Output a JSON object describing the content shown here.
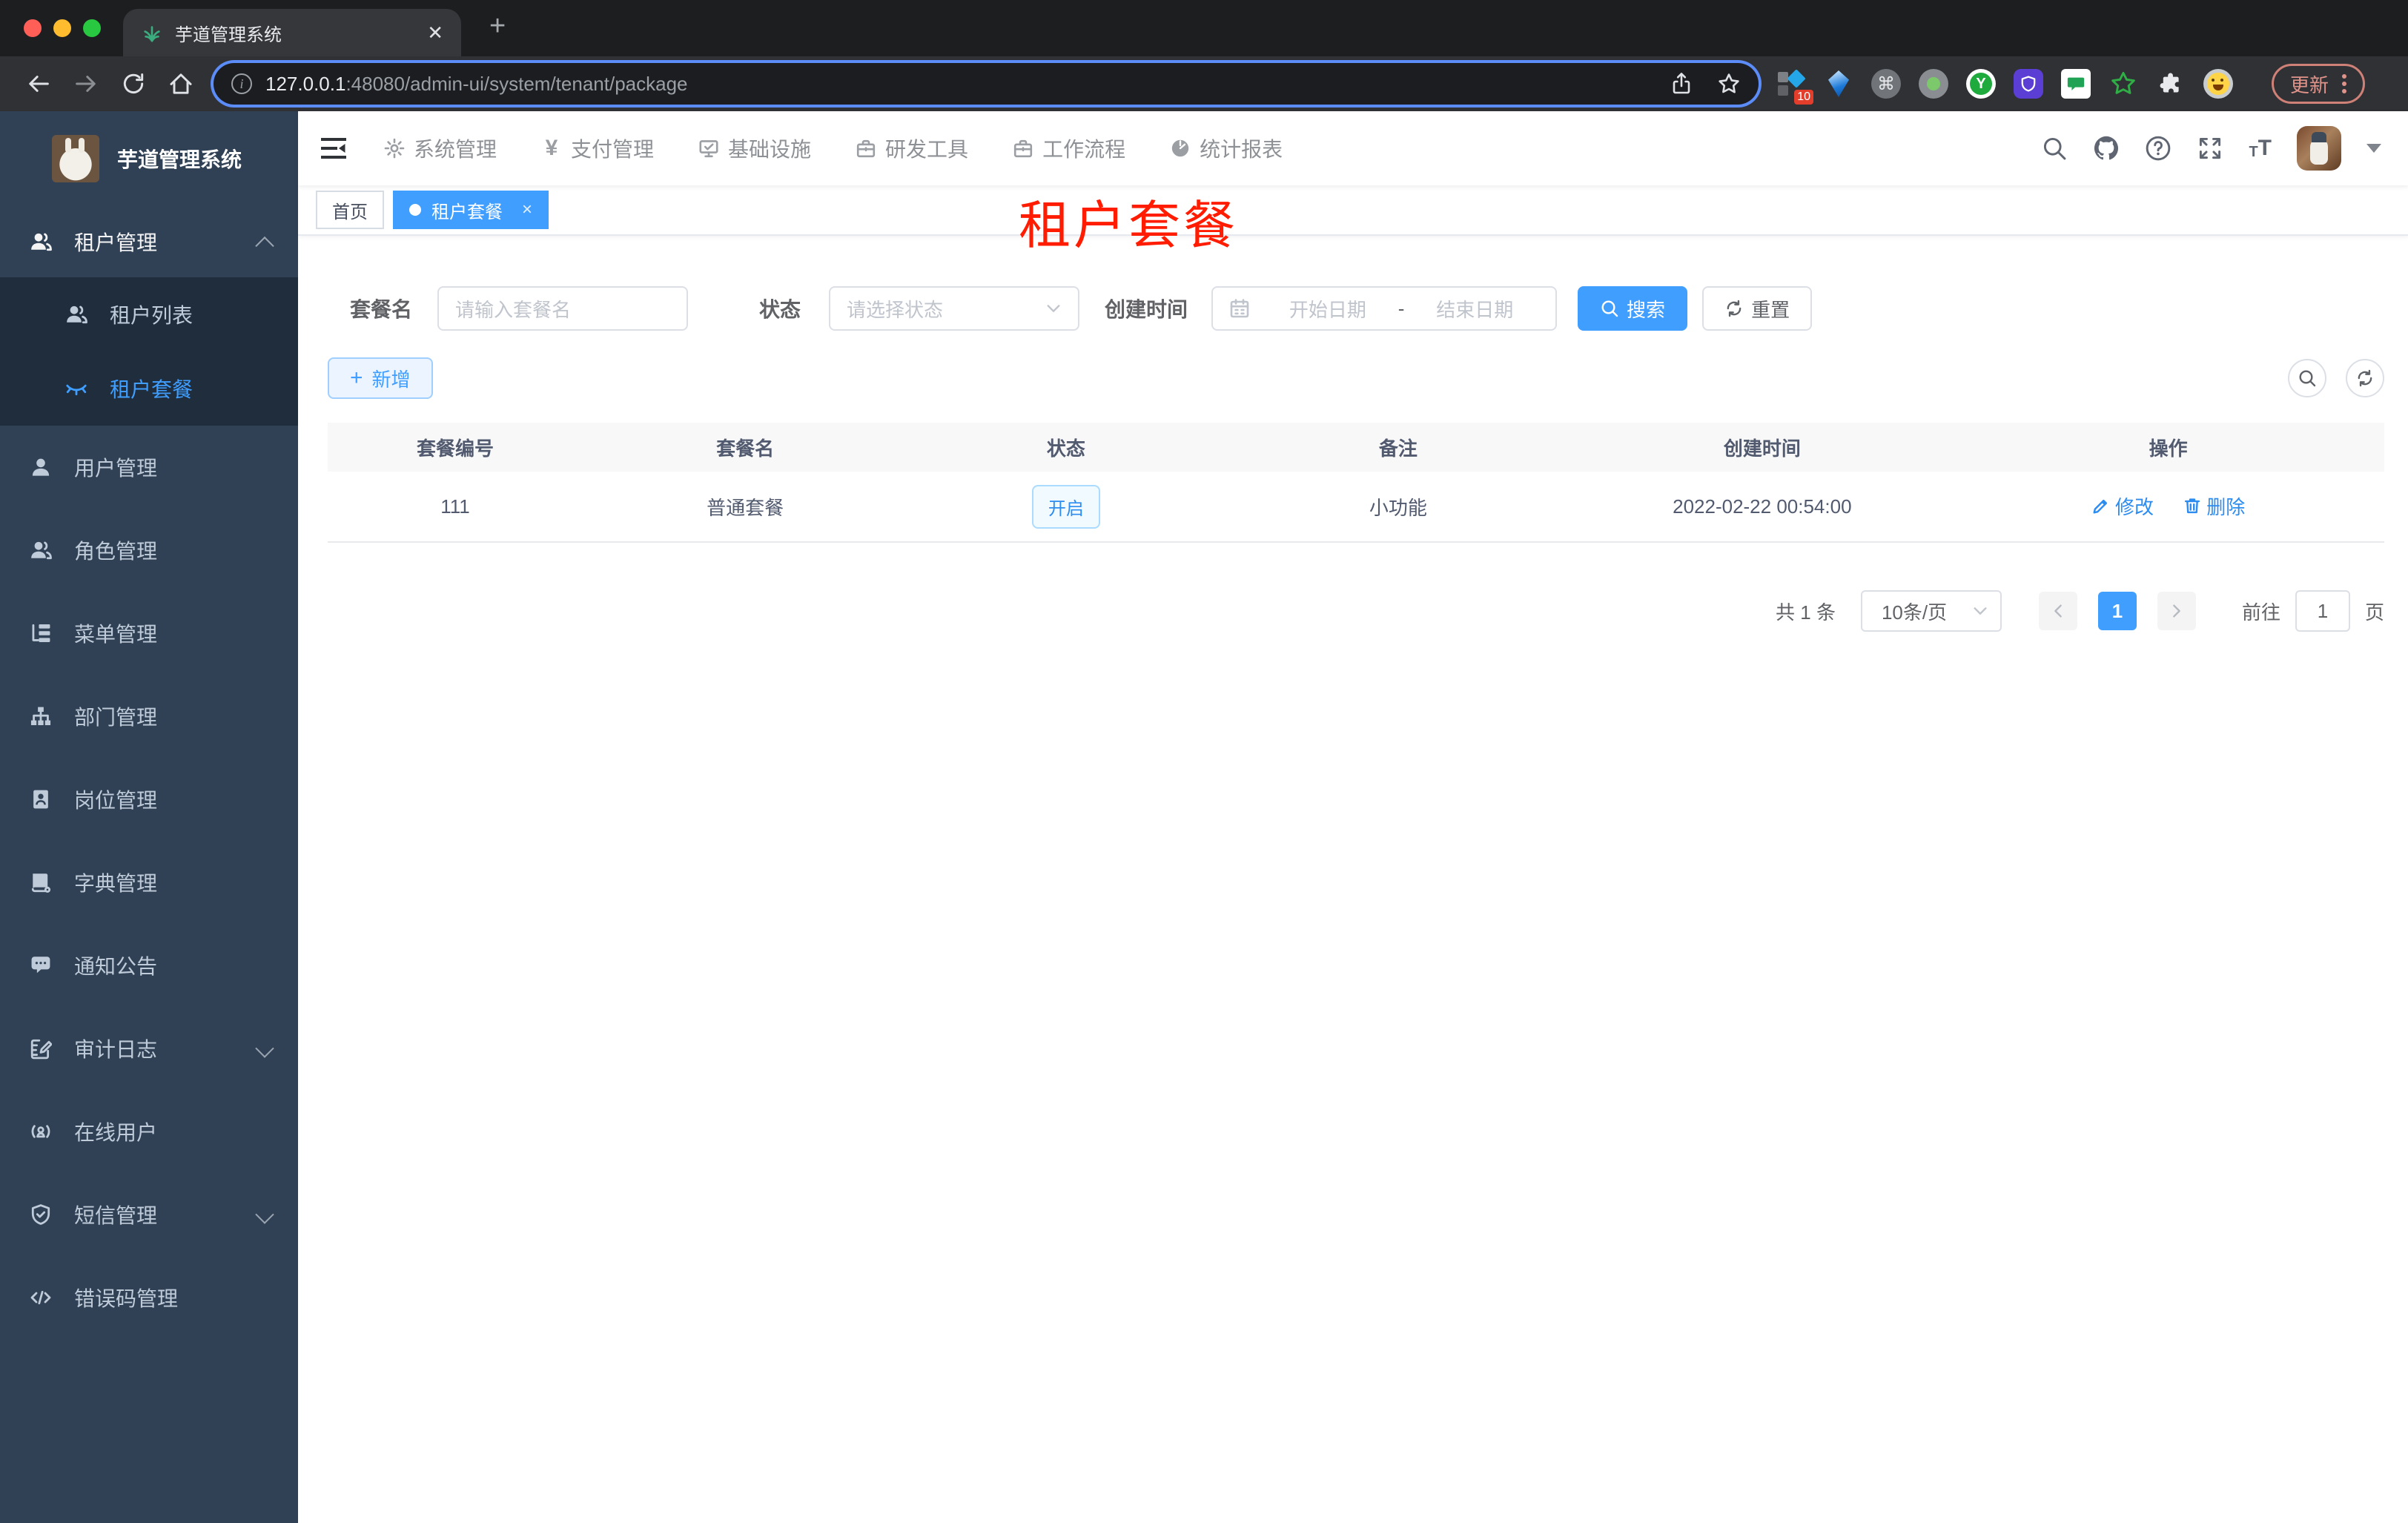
{
  "browser": {
    "tab_title": "芋道管理系统",
    "url_host": "127.0.0.1",
    "url_rest": ":48080/admin-ui/system/tenant/package",
    "update_label": "更新",
    "extension_badge": "10",
    "extension_y_letter": "Y"
  },
  "colors": {
    "primary": "#409EFF",
    "sidebar_bg": "#304156",
    "submenu_bg": "#1F2D3D",
    "page_title_red": "#FF1C00",
    "tag_active": "#409EFF"
  },
  "sidebar": {
    "logo_title": "芋道管理系统",
    "items": [
      {
        "label": "租户管理",
        "icon": "users-icon",
        "expanded": true
      },
      {
        "label": "租户列表",
        "icon": "users-icon"
      },
      {
        "label": "租户套餐",
        "icon": "closed-eye-icon",
        "active": true
      },
      {
        "label": "用户管理",
        "icon": "user-icon"
      },
      {
        "label": "角色管理",
        "icon": "users-icon"
      },
      {
        "label": "菜单管理",
        "icon": "tree-menu-icon"
      },
      {
        "label": "部门管理",
        "icon": "org-chart-icon"
      },
      {
        "label": "岗位管理",
        "icon": "id-badge-icon"
      },
      {
        "label": "字典管理",
        "icon": "dictionary-icon"
      },
      {
        "label": "通知公告",
        "icon": "message-icon"
      },
      {
        "label": "审计日志",
        "icon": "audit-log-icon",
        "collapsible": true
      },
      {
        "label": "在线用户",
        "icon": "online-user-icon"
      },
      {
        "label": "短信管理",
        "icon": "shield-icon",
        "collapsible": true
      },
      {
        "label": "错误码管理",
        "icon": "code-icon"
      }
    ]
  },
  "topnav": {
    "items": [
      {
        "label": "系统管理",
        "icon": "gear-icon"
      },
      {
        "label": "支付管理",
        "icon": "yen-icon"
      },
      {
        "label": "基础设施",
        "icon": "monitor-icon"
      },
      {
        "label": "研发工具",
        "icon": "briefcase-icon"
      },
      {
        "label": "工作流程",
        "icon": "briefcase-icon"
      },
      {
        "label": "统计报表",
        "icon": "dashboard-icon"
      }
    ],
    "yen_glyph": "¥"
  },
  "tags": {
    "items": [
      {
        "label": "首页"
      },
      {
        "label": "租户套餐",
        "active": true,
        "close": "×"
      }
    ]
  },
  "page_title": "租户套餐",
  "filters": {
    "name_label": "套餐名",
    "name_placeholder": "请输入套餐名",
    "status_label": "状态",
    "status_placeholder": "请选择状态",
    "date_label": "创建时间",
    "date_start_placeholder": "开始日期",
    "date_separator": "-",
    "date_end_placeholder": "结束日期",
    "search_label": "搜索",
    "reset_label": "重置"
  },
  "toolbar": {
    "add_label": "新增"
  },
  "table": {
    "headers": [
      "套餐编号",
      "套餐名",
      "状态",
      "备注",
      "创建时间",
      "操作"
    ],
    "rows": [
      {
        "id": "111",
        "name": "普通套餐",
        "status": "开启",
        "remark": "小功能",
        "created": "2022-02-22 00:54:00",
        "edit_label": "修改",
        "delete_label": "删除"
      }
    ]
  },
  "pagination": {
    "total": "共 1 条",
    "page_size": "10条/页",
    "current_page": "1",
    "goto_label": "前往",
    "goto_value": "1",
    "page_unit": "页"
  }
}
